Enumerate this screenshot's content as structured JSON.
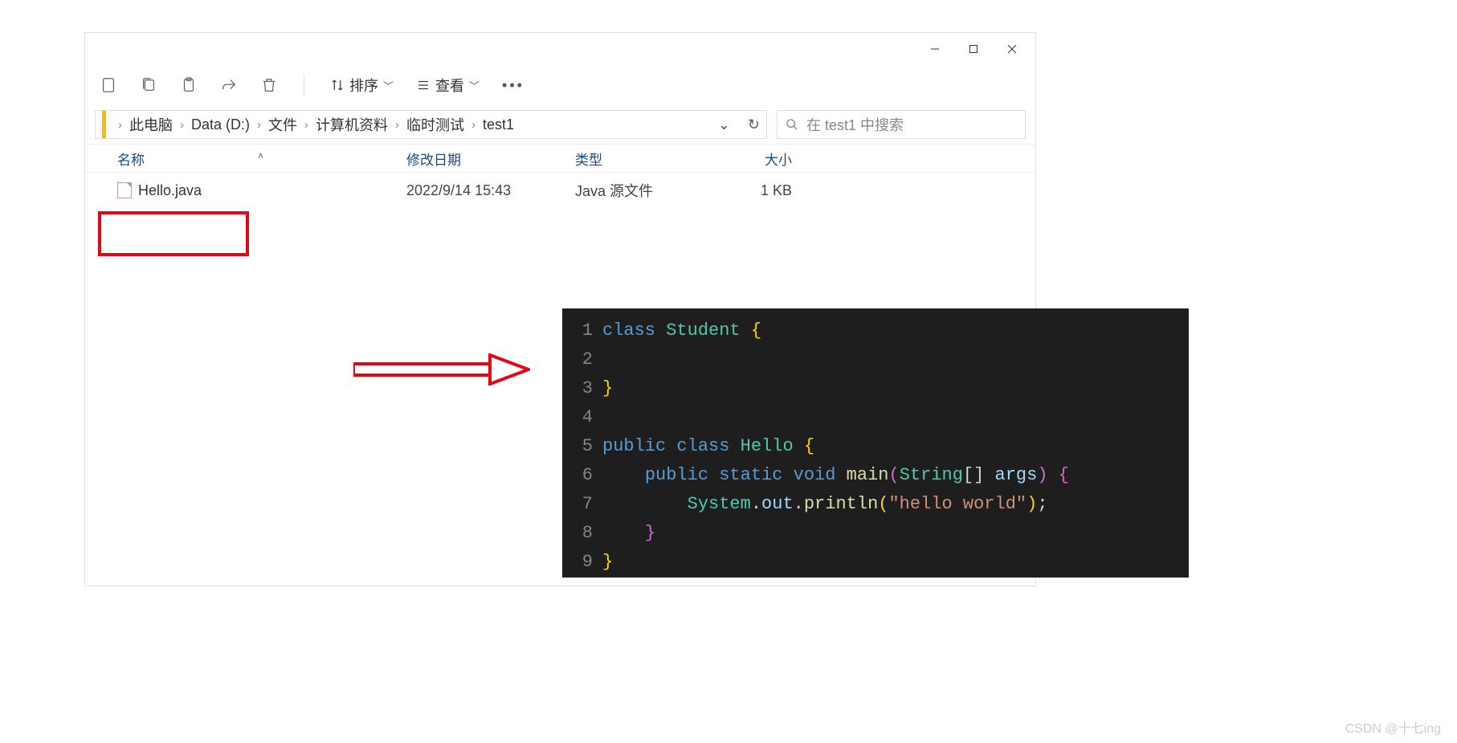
{
  "window": {
    "toolbar": {
      "sort_label": "排序",
      "view_label": "查看"
    },
    "breadcrumb": [
      "此电脑",
      "Data (D:)",
      "文件",
      "计算机资料",
      "临时测试",
      "test1"
    ],
    "search_placeholder": "在 test1 中搜索",
    "columns": {
      "name": "名称",
      "date": "修改日期",
      "type": "类型",
      "size": "大小"
    },
    "file": {
      "name": "Hello.java",
      "date": "2022/9/14 15:43",
      "type": "Java 源文件",
      "size": "1 KB"
    }
  },
  "code": {
    "lines": [
      "1",
      "2",
      "3",
      "4",
      "5",
      "6",
      "7",
      "8",
      "9"
    ],
    "l1_kw": "class",
    "l1_cls": "Student",
    "l5_kw1": "public",
    "l5_kw2": "class",
    "l5_cls": "Hello",
    "l6_kw1": "public",
    "l6_kw2": "static",
    "l6_kw3": "void",
    "l6_fn": "main",
    "l6_type": "String",
    "l6_arg": "args",
    "l7_obj": "System",
    "l7_p1": "out",
    "l7_p2": "println",
    "l7_str": "\"hello world\""
  },
  "watermark": "CSDN @十七ing"
}
